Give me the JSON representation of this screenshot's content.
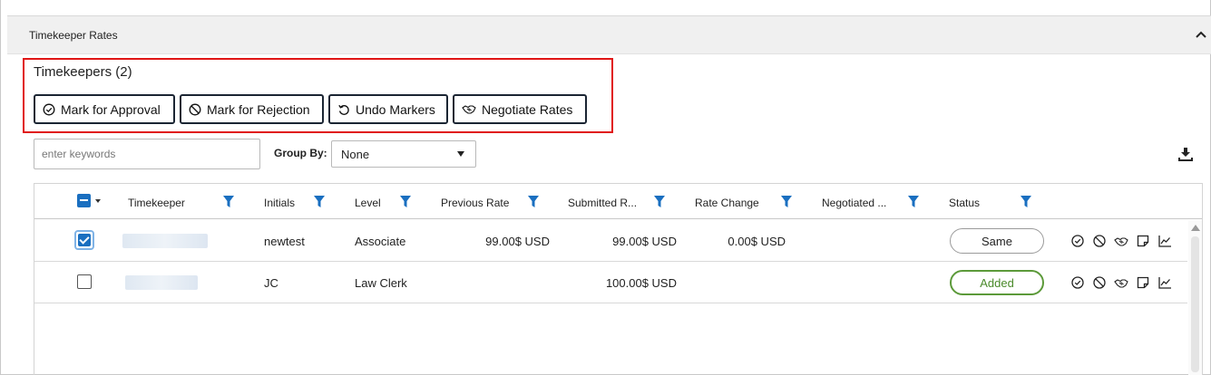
{
  "section": {
    "title": "Timekeeper Rates"
  },
  "timekeepers": {
    "title": "Timekeepers (2)"
  },
  "actions": {
    "approve_label": "Mark for Approval",
    "reject_label": "Mark for Rejection",
    "undo_label": "Undo Markers",
    "negotiate_label": "Negotiate Rates"
  },
  "search": {
    "placeholder": "enter keywords",
    "value": ""
  },
  "group_by": {
    "label": "Group By:",
    "selected": "None"
  },
  "columns": {
    "timekeeper": "Timekeeper",
    "initials": "Initials",
    "level": "Level",
    "previous_rate": "Previous Rate",
    "submitted_rate": "Submitted R...",
    "rate_change": "Rate Change",
    "negotiated": "Negotiated ...",
    "status": "Status"
  },
  "rows": [
    {
      "checked": true,
      "initials": "newtest",
      "level": "Associate",
      "previous_rate": "99.00$ USD",
      "submitted_rate": "99.00$ USD",
      "rate_change": "0.00$ USD",
      "negotiated": "",
      "status": "Same"
    },
    {
      "checked": false,
      "initials": "JC",
      "level": "Law Clerk",
      "previous_rate": "",
      "submitted_rate": "100.00$ USD",
      "rate_change": "",
      "negotiated": "",
      "status": "Added"
    }
  ],
  "colors": {
    "accent": "#1a6fc0",
    "highlight_border": "#e01616",
    "status_added": "#5c9a3a",
    "button_border": "#1b2533"
  }
}
